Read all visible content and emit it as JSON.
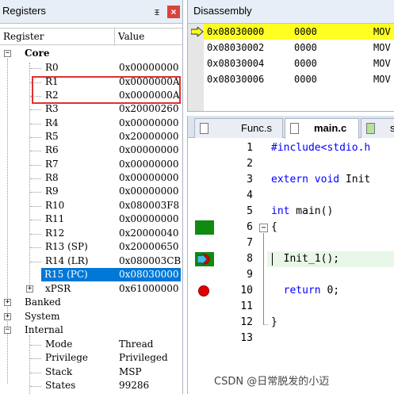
{
  "registers": {
    "title": "Registers",
    "pin_glyph": "ᵻ",
    "close_glyph": "×",
    "col_register": "Register",
    "col_value": "Value",
    "core": {
      "label": "Core",
      "items": [
        {
          "name": "R0",
          "value": "0x00000000"
        },
        {
          "name": "R1",
          "value": "0x0000000A"
        },
        {
          "name": "R2",
          "value": "0x0000000A"
        },
        {
          "name": "R3",
          "value": "0x20000260"
        },
        {
          "name": "R4",
          "value": "0x00000000"
        },
        {
          "name": "R5",
          "value": "0x20000000"
        },
        {
          "name": "R6",
          "value": "0x00000000"
        },
        {
          "name": "R7",
          "value": "0x00000000"
        },
        {
          "name": "R8",
          "value": "0x00000000"
        },
        {
          "name": "R9",
          "value": "0x00000000"
        },
        {
          "name": "R10",
          "value": "0x080003F8"
        },
        {
          "name": "R11",
          "value": "0x00000000"
        },
        {
          "name": "R12",
          "value": "0x20000040"
        },
        {
          "name": "R13 (SP)",
          "value": "0x20000650"
        },
        {
          "name": "R14 (LR)",
          "value": "0x080003CB"
        },
        {
          "name": "R15 (PC)",
          "value": "0x08030000"
        },
        {
          "name": "xPSR",
          "value": "0x61000000"
        }
      ]
    },
    "banked": {
      "label": "Banked"
    },
    "system": {
      "label": "System"
    },
    "internal": {
      "label": "Internal",
      "items": [
        {
          "name": "Mode",
          "value": "Thread"
        },
        {
          "name": "Privilege",
          "value": "Privileged"
        },
        {
          "name": "Stack",
          "value": "MSP"
        },
        {
          "name": "States",
          "value": "99286"
        }
      ]
    }
  },
  "disassembly": {
    "title": "Disassembly",
    "rows": [
      {
        "addr": "0x08030000",
        "code": "0000",
        "mnem": "MOV"
      },
      {
        "addr": "0x08030002",
        "code": "0000",
        "mnem": "MOV"
      },
      {
        "addr": "0x08030004",
        "code": "0000",
        "mnem": "MOV"
      },
      {
        "addr": "0x08030006",
        "code": "0000",
        "mnem": "MOV"
      }
    ]
  },
  "editor": {
    "tabs": [
      {
        "label": "Func.s"
      },
      {
        "label": "main.c"
      },
      {
        "label": "s"
      }
    ],
    "lines": [
      {
        "num": "1",
        "code": "#include<stdio.h"
      },
      {
        "num": "2",
        "code": ""
      },
      {
        "num": "3",
        "kw": "extern void",
        "rest": " Init"
      },
      {
        "num": "4",
        "code": ""
      },
      {
        "num": "5",
        "kw": "int",
        "rest": " main()"
      },
      {
        "num": "6",
        "code": "{"
      },
      {
        "num": "7",
        "code": ""
      },
      {
        "num": "8",
        "code": "  Init_1();"
      },
      {
        "num": "9",
        "code": ""
      },
      {
        "num": "10",
        "kw": "  return",
        "rest": " 0;"
      },
      {
        "num": "11",
        "code": ""
      },
      {
        "num": "12",
        "code": "}"
      },
      {
        "num": "13",
        "code": ""
      }
    ]
  },
  "watermark": "CSDN @日常脱发的小迈",
  "colors": {
    "selection": "#0078d7",
    "current_instruction": "#ffff22",
    "highlight_box": "#e03030",
    "breakpoint": "#e00000",
    "keyword": "#0000ff"
  }
}
